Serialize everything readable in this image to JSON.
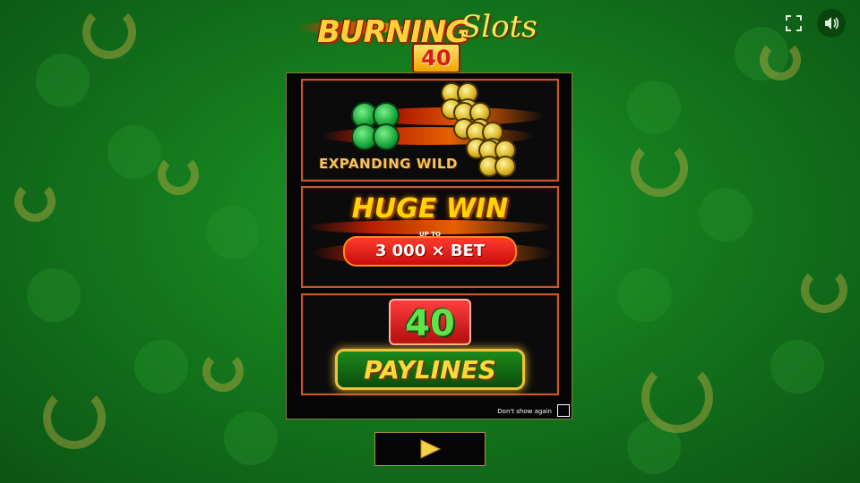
{
  "logo": {
    "line1": "BURNING",
    "line2": "Slots",
    "badge": "40"
  },
  "controls": {
    "fullscreen_icon": "fullscreen-icon",
    "sound_icon": "speaker-icon"
  },
  "cards": {
    "expanding_wild": "EXPANDING WILD",
    "huge_win": "HUGE WIN",
    "up_to": "UP TO",
    "bet": "3 000 × BET",
    "paylines_number": "40",
    "paylines_label": "PAYLINES"
  },
  "dont_show_again": "Don't show again",
  "play_button_icon": "play-icon",
  "colors": {
    "accent_gold": "#f0c23a",
    "background_green": "#14791d",
    "fire_red": "#c80d0d"
  }
}
